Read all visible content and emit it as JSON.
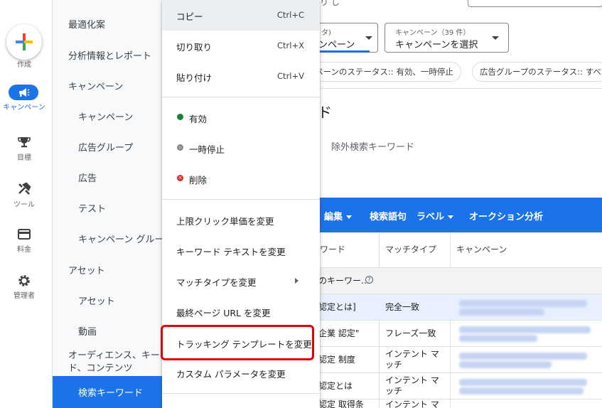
{
  "rail": {
    "create": "作成",
    "campaigns": "キャンペーン",
    "goals": "目標",
    "tools": "ツール",
    "billing": "料金",
    "admin": "管理者"
  },
  "nav": {
    "items": [
      "最適化案",
      "分析情報とレポート",
      "キャンペーン",
      "キャンペーン",
      "広告グループ",
      "広告",
      "テスト",
      "キャンペーン グルー",
      "アセット",
      "アセット",
      "動画",
      "オーディエンス、キー",
      "ド、コンテンツ"
    ],
    "active": "検索キーワード"
  },
  "background": {
    "top_text": "り し   ",
    "filter_view_small": "タ)",
    "filter_view_value": "ンペーン",
    "campaign_select_small": "キャンペーン（39 件）",
    "campaign_select_value": "キャンペーンを選択",
    "chip_campaign_status": "ペーンのステータス:: 有効、一時停止",
    "chip_adgroup_status": "広告グループのステータス:: すべ",
    "page_title": "ド",
    "tab_negative": "除外検索キーワード",
    "toolbar": {
      "edit": "編集",
      "search_terms": "検索語句",
      "labels": "ラベル",
      "auction": "オークション分析"
    },
    "table": {
      "headers": [
        "ワード",
        "マッチタイプ",
        "キャンペーン"
      ],
      "summary_label": "のキーワー…",
      "rows": [
        {
          "keyword": "認定とは]",
          "match": "完全一致"
        },
        {
          "keyword": "企業 認定\"",
          "match": "フレーズ一致"
        },
        {
          "keyword": "認定 制度",
          "match": "インテント マ\nッチ"
        },
        {
          "keyword": "認定とは",
          "match": "インテント マ\nッチ"
        },
        {
          "keyword": "認定 取得条",
          "match": "インテント マ"
        }
      ]
    }
  },
  "menu": {
    "copy": "コピー",
    "copy_shortcut": "Ctrl+C",
    "cut": "切り取り",
    "cut_shortcut": "Ctrl+X",
    "paste": "貼り付け",
    "paste_shortcut": "Ctrl+V",
    "enable": "有効",
    "pause": "一時停止",
    "remove": "削除",
    "change_max_cpc": "上限クリック単価を変更",
    "change_keyword_text": "キーワード テキストを変更",
    "change_match_type": "マッチタイプを変更",
    "change_final_url": "最終ページ URL を変更",
    "change_tracking_template": "トラッキング テンプレートを変更",
    "change_custom_params": "カスタム パラメータを変更"
  },
  "colors": {
    "accent": "#1a73e8",
    "enabled": "#188038",
    "paused": "#80868b",
    "removed": "#d93025",
    "highlight": "#e3000b"
  }
}
